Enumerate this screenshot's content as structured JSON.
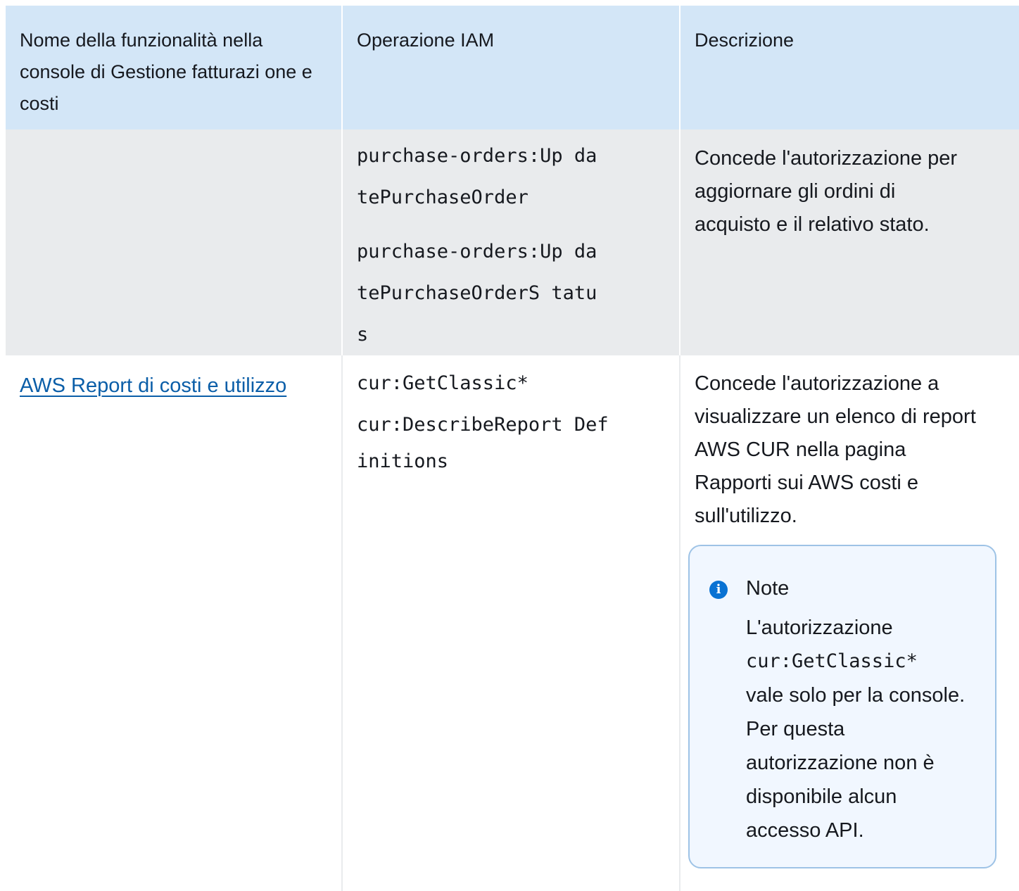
{
  "table": {
    "headers": [
      "Nome della funzionalità nella console di Gestione fatturazi one e costi",
      "Operazione IAM",
      "Descrizione"
    ],
    "rows": [
      {
        "feature": "",
        "actions": [
          "purchase-orders:Up datePurchaseOrder",
          "purchase-orders:Up datePurchaseOrderS tatus"
        ],
        "description": "Concede l'autorizzazione per aggiornare gli ordini di acquisto e il relativo stato."
      },
      {
        "feature": "AWS Report di costi e utilizzo",
        "actions": [
          "cur:GetClassic*",
          "cur:DescribeReport Definitions"
        ],
        "description": "Concede l'autorizzazione a visualizzare un elenco di report AWS CUR nella pagina Rapporti sui AWS costi e sull'utilizzo."
      }
    ]
  },
  "note": {
    "icon": "info-icon",
    "title": "Note",
    "body_before": "L'autorizzazione",
    "code": "cur:GetClassic*",
    "body_after": "vale solo per la console. Per questa autorizzazione non è disponibile alcun accesso API."
  },
  "colors": {
    "header_bg": "#d3e6f7",
    "row_grey_bg": "#e9ebed",
    "link": "#0b5ea8",
    "note_border": "#9ec3e6",
    "note_bg": "#f1f7ff",
    "info_icon": "#0972d3"
  }
}
